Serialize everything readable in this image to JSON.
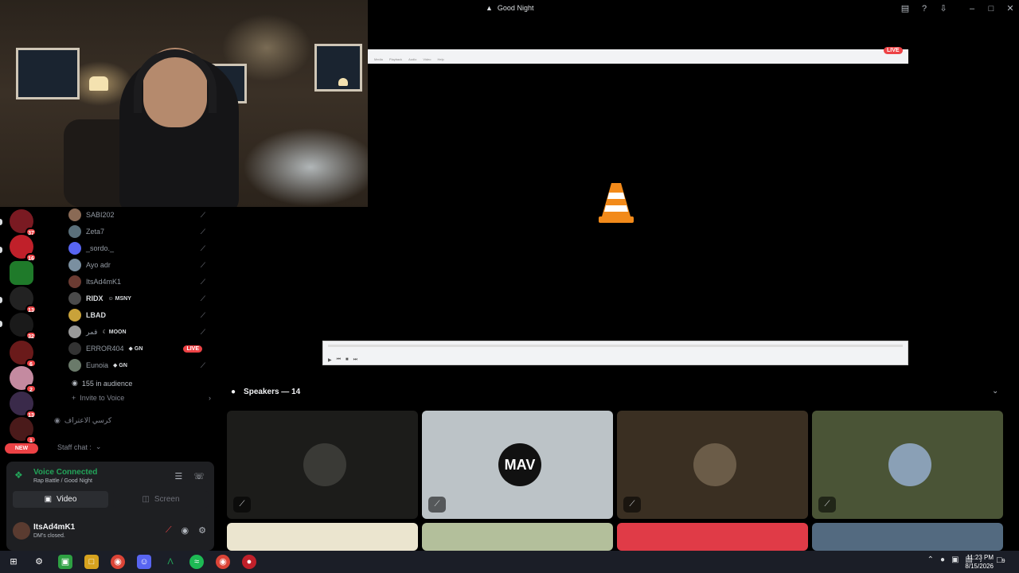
{
  "window": {
    "title": "Good Night"
  },
  "stage": {
    "live_label": "LIVE",
    "menu": [
      "Media",
      "Playback",
      "Audio",
      "Video",
      "Help"
    ]
  },
  "members": [
    {
      "name": "SABI202",
      "tag": "",
      "color": "#8a6a55"
    },
    {
      "name": "Zeta7",
      "tag": "",
      "color": "#5a6f7a"
    },
    {
      "name": "_sordo._",
      "tag": "",
      "color": "#5865f2"
    },
    {
      "name": "Ayo adr",
      "tag": "",
      "color": "#7a8fa0"
    },
    {
      "name": "ItsAd4mK1",
      "tag": "",
      "color": "#6b3b32"
    },
    {
      "name": "RIDX",
      "tag": "MSNY",
      "color": "#4a4a4a"
    },
    {
      "name": "LBAD",
      "tag": "",
      "color": "#c9a23a"
    },
    {
      "name": "قمر",
      "tag": "MOON",
      "color": "#9a9a9a"
    },
    {
      "name": "ERROR404",
      "tag": "GN",
      "color": "#333333",
      "live": "LIVE"
    },
    {
      "name": "Eunoia",
      "tag": "GN",
      "color": "#6a7a6a"
    }
  ],
  "audience": {
    "label": "155 in audience"
  },
  "invite": {
    "label": "Invite to Voice"
  },
  "channels": {
    "voice_channel": "كرسي الاعتراف",
    "staff_chat": "Staff chat :"
  },
  "servers": [
    {
      "badge": "37"
    },
    {
      "badge": "16"
    },
    {
      "badge": ""
    },
    {
      "badge": "13"
    },
    {
      "badge": "32"
    },
    {
      "badge": "6"
    },
    {
      "badge": "2"
    },
    {
      "badge": "13"
    },
    {
      "badge": "1"
    }
  ],
  "new_label": "NEW",
  "voice": {
    "status": "Voice Connected",
    "subtitle": "Rap Battle / Good Night",
    "video_label": "Video",
    "screen_label": "Screen"
  },
  "user": {
    "name": "ItsAd4mK1",
    "status": "DM's closed."
  },
  "speakers": {
    "header": "Speakers — 14",
    "tiles": [
      {
        "bg": "#1c1c1a",
        "avatar": "#3a3a36"
      },
      {
        "bg": "#bcc3c7",
        "avatar": "#111111",
        "text": "MAV"
      },
      {
        "bg": "#3a2f22",
        "avatar": "#6b5c48"
      },
      {
        "bg": "#4a5436",
        "avatar": "#8aa0b6"
      },
      {
        "bg": "#ebe5cf"
      },
      {
        "bg": "#b3bf9b"
      },
      {
        "bg": "#e03b47"
      },
      {
        "bg": "#536a80"
      }
    ]
  },
  "taskbar": {
    "time": "11:23 PM",
    "date": "8/15/2026",
    "notif_count": "9"
  }
}
